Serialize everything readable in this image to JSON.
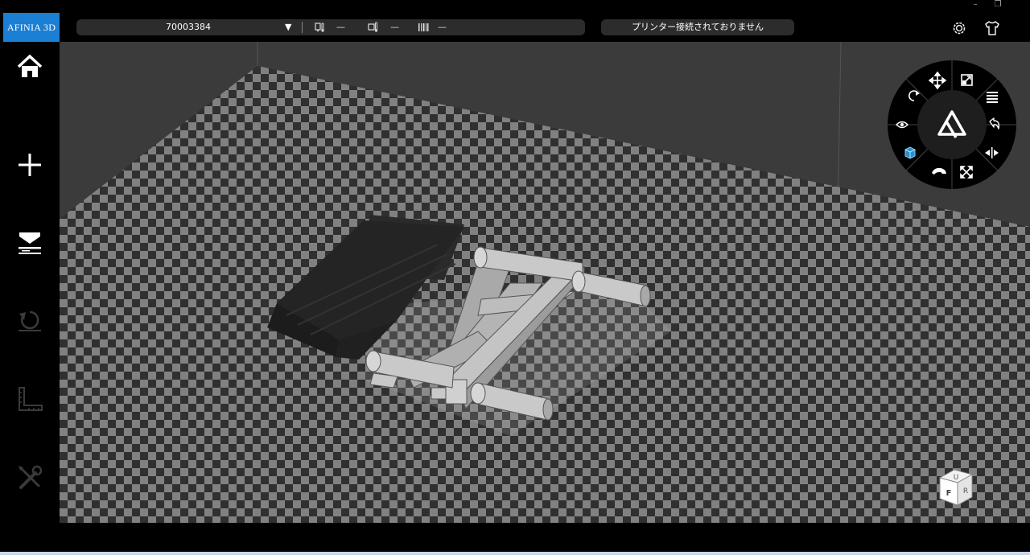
{
  "app": {
    "logo_text": "AFINIA 3D",
    "window_controls": [
      "–",
      "❐"
    ]
  },
  "printer": {
    "id": "70003384",
    "caret": "▼",
    "nozzle_temp": "—",
    "bed_temp": "—",
    "filament": "—",
    "status": "プリンター接続されておりません"
  },
  "viewcube": {
    "faces": [
      "U",
      "F",
      "R"
    ]
  },
  "colors": {
    "accent": "#1b7fd4",
    "background": "#000000",
    "viewport": "#3b3b3b",
    "checker_light": "#8c8c8c",
    "checker_dark": "#353535"
  },
  "icons": {
    "sidebar": [
      "home-icon",
      "add-icon",
      "print-icon",
      "undo-icon",
      "measure-icon",
      "tools-icon"
    ],
    "topbar": [
      "settings-icon",
      "shirt-icon"
    ],
    "radial": [
      "move-icon",
      "scale-icon",
      "layers-icon",
      "rotate-icon",
      "view-icon",
      "reset-icon",
      "cube-icon",
      "mirror-icon",
      "hand-icon",
      "autoplace-icon"
    ]
  }
}
